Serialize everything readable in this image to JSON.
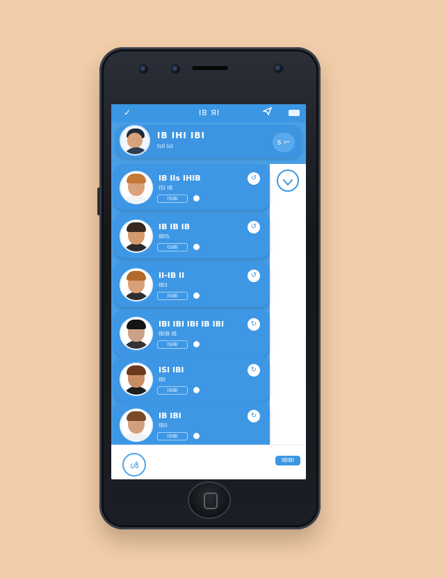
{
  "statusbar": {
    "left_icon": "✓",
    "time": "IB ЯI",
    "send_icon": "send-icon",
    "battery_icon": "battery-icon"
  },
  "header": {
    "title": "IB IHI IBI",
    "subtitle": "IsII IsI",
    "action_label": "s ⌐"
  },
  "contacts": [
    {
      "name": "IB IIs IHIB",
      "sub": "ISI   IB",
      "tag": "ISIBI",
      "icon": "↺",
      "hair": "#c47a35",
      "face": "#d9a27a",
      "shirt": "#f4f4f4"
    },
    {
      "name": "IB IB IB",
      "sub": "IBIS",
      "tag": "ISIBI",
      "icon": "↺",
      "hair": "#3a2a1e",
      "face": "#d49a6c",
      "shirt": "#2b2b2b"
    },
    {
      "name": "II-IB II",
      "sub": "IBII",
      "tag": "ISIBI",
      "icon": "↺",
      "hair": "#b36a2c",
      "face": "#d8a07a",
      "shirt": "#2d2d2d"
    },
    {
      "name": "IBI IBI IBI IB IBI",
      "sub": "IBIB IB",
      "tag": "ISIBI",
      "icon": "↻",
      "hair": "#151515",
      "face": "#caa184",
      "shirt": "#333333"
    },
    {
      "name": "ISI IBI",
      "sub": "IBI",
      "tag": "ISIBI",
      "icon": "↻",
      "hair": "#6b3a1e",
      "face": "#c98d62",
      "shirt": "#1f1f1f"
    },
    {
      "name": "IB IBI",
      "sub": "IBII",
      "tag": "ISIBI",
      "icon": "↻",
      "hair": "#7a4a26",
      "face": "#d4a07b",
      "shirt": "#f2f2f2"
    }
  ],
  "edit_icon": "edit-icon",
  "fab_label": "ൾ",
  "pill_label": "IBIBI",
  "colors": {
    "accent": "#3b97e3",
    "panel": "#4a9fe6",
    "background": "#f1cda9"
  }
}
